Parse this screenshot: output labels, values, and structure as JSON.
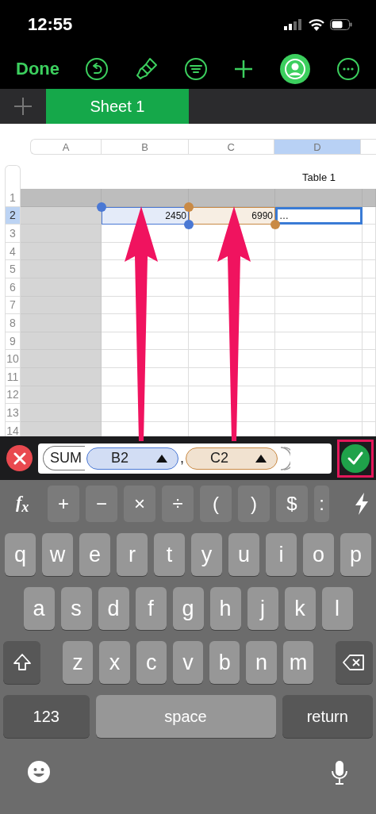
{
  "status_bar": {
    "time": "12:55"
  },
  "toolbar": {
    "done": "Done"
  },
  "sheet_tabs": [
    {
      "label": "Sheet 1",
      "selected": true
    }
  ],
  "table": {
    "title": "Table 1",
    "columns": [
      {
        "label": "A",
        "kind": "header",
        "selected": false
      },
      {
        "label": "B",
        "kind": "body",
        "selected": false
      },
      {
        "label": "C",
        "kind": "body",
        "selected": false
      },
      {
        "label": "D",
        "kind": "body",
        "selected": true
      }
    ],
    "rows": [
      {
        "label": "1",
        "kind": "header",
        "selected": false
      },
      {
        "label": "2",
        "kind": "body",
        "selected": true,
        "cells": [
          {
            "kind": "plain"
          },
          {
            "kind": "reference",
            "text": "2450",
            "color": "#4a78d4"
          },
          {
            "kind": "reference",
            "text": "6990",
            "color": "#c98a45"
          },
          {
            "kind": "editing",
            "text": "…"
          }
        ]
      },
      {
        "label": "3",
        "kind": "body",
        "selected": false
      },
      {
        "label": "4",
        "kind": "body",
        "selected": false
      },
      {
        "label": "5",
        "kind": "body",
        "selected": false
      },
      {
        "label": "6",
        "kind": "body",
        "selected": false
      },
      {
        "label": "7",
        "kind": "body",
        "selected": false
      },
      {
        "label": "8",
        "kind": "body",
        "selected": false
      },
      {
        "label": "9",
        "kind": "body",
        "selected": false
      },
      {
        "label": "10",
        "kind": "body",
        "selected": false
      },
      {
        "label": "11",
        "kind": "body",
        "selected": false
      },
      {
        "label": "12",
        "kind": "body",
        "selected": false
      },
      {
        "label": "13",
        "kind": "body",
        "selected": false
      },
      {
        "label": "14",
        "kind": "body",
        "selected": false
      }
    ]
  },
  "formula": {
    "tokens": [
      {
        "kind": "function",
        "text": "SUM"
      },
      {
        "kind": "reference",
        "text": "B2",
        "color": "#4a78d4"
      },
      {
        "kind": "separator",
        "text": ","
      },
      {
        "kind": "reference",
        "text": "C2",
        "color": "#c98a45"
      }
    ]
  },
  "keyboard": {
    "fx": "f$_{x}$",
    "operators": [
      "+",
      "−",
      "×",
      "÷",
      "(",
      ")",
      "$",
      ":"
    ],
    "rows": [
      [
        "q",
        "w",
        "e",
        "r",
        "t",
        "y",
        "u",
        "i",
        "o",
        "p"
      ],
      [
        "a",
        "s",
        "d",
        "f",
        "g",
        "h",
        "j",
        "k",
        "l"
      ],
      [
        "z",
        "x",
        "c",
        "v",
        "b",
        "n",
        "m"
      ]
    ],
    "numbers": "123",
    "space": "space",
    "return": "return"
  }
}
